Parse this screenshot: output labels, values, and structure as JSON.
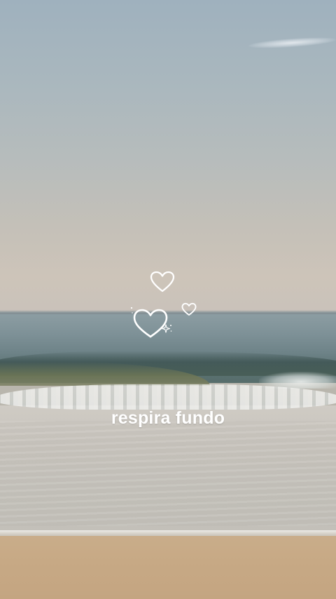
{
  "story": {
    "caption": "respira fundo"
  },
  "stickers": {
    "icons": [
      "heart-outline-icon",
      "heart-outline-icon",
      "heart-outline-icon",
      "sparkle-icon"
    ],
    "color": "#ffffff"
  },
  "palette": {
    "sky_top": "#9fb1be",
    "sky_horizon": "#cdc4b9",
    "sea": "#6f8489",
    "foam": "#f2f3f1",
    "wet_sand": "#c8c4bd",
    "dry_sand": "#c7a985"
  }
}
